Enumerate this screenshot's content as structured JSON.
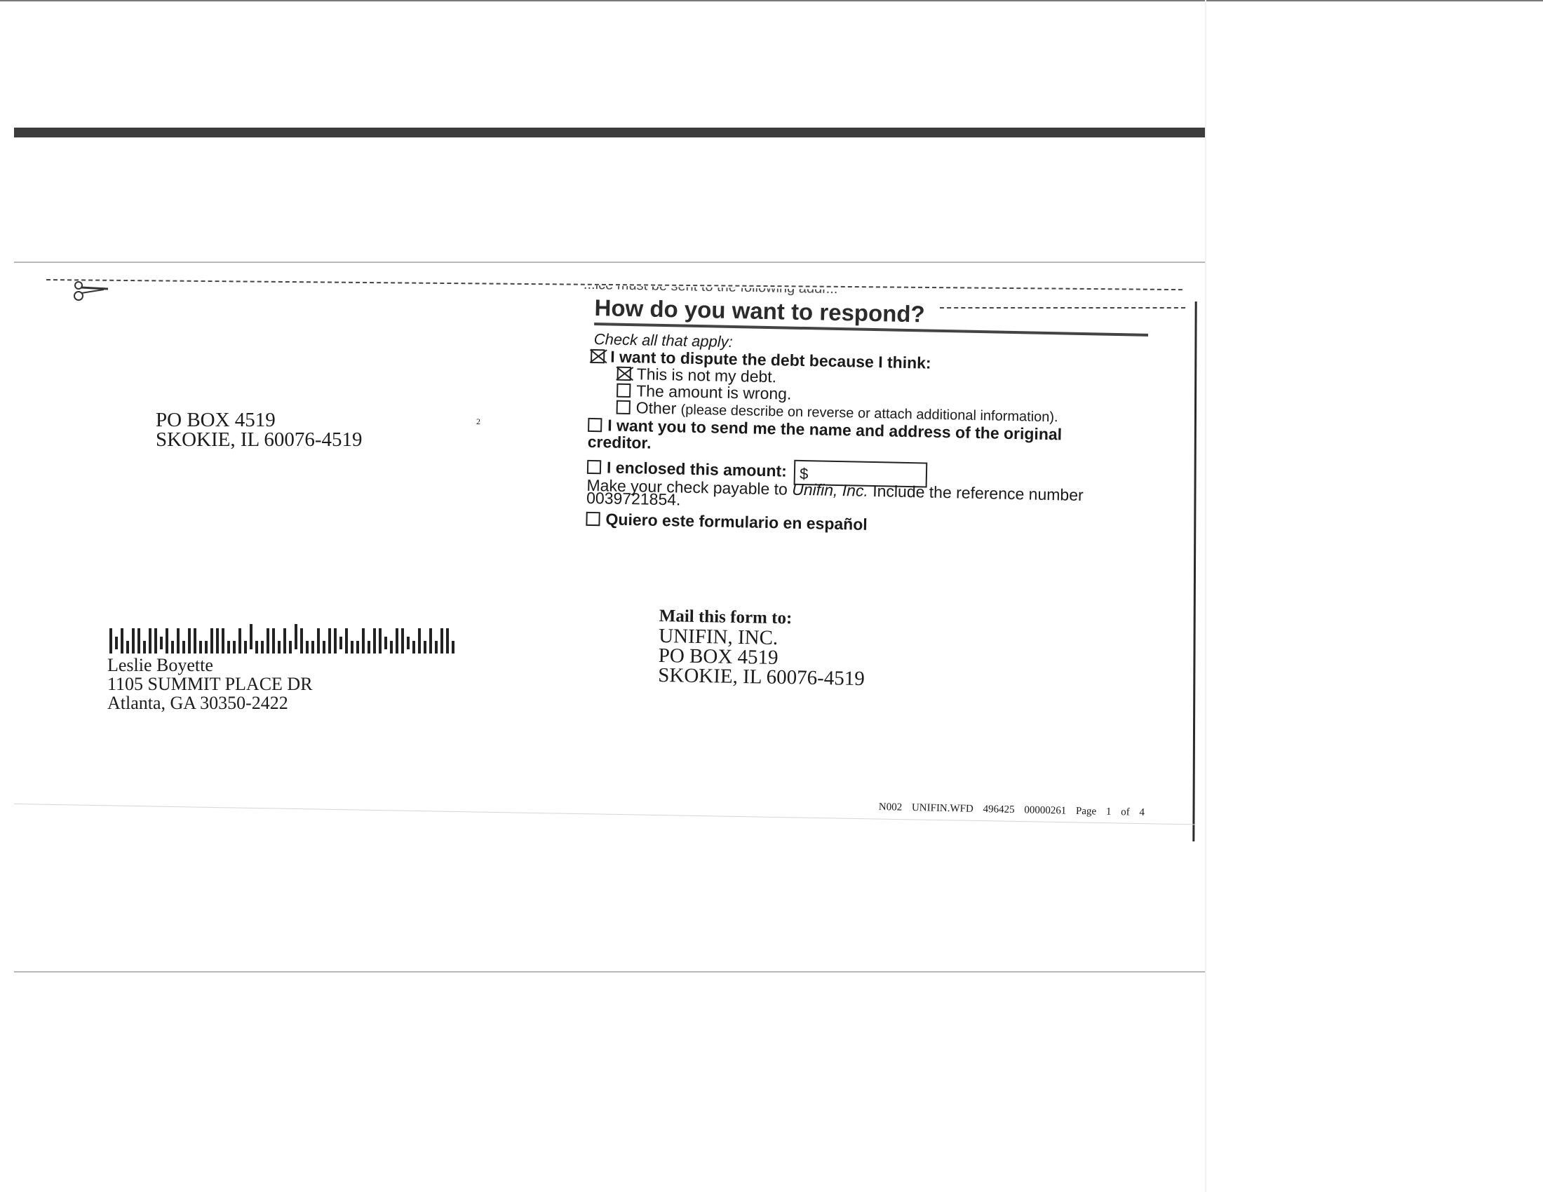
{
  "header": {
    "cut_text": "...ice must be sent to the following addr..."
  },
  "return_address": {
    "line1": "PO BOX 4519",
    "line2": "SKOKIE, IL 60076-4519",
    "marker": "2"
  },
  "form": {
    "title": "How do you want to respond?",
    "check_all": "Check all that apply:",
    "dispute_label": "I want to dispute the debt because I think:",
    "dispute_checked": true,
    "not_my_debt": "This is not my debt.",
    "not_my_debt_checked": true,
    "amount_wrong": "The amount is wrong.",
    "other_label": "Other",
    "other_note": "(please describe on reverse or attach additional information).",
    "creditor_line1": "I want you to send me the name and address of the original",
    "creditor_line2": "creditor.",
    "enclosed_label": "I enclosed this amount:",
    "enclosed_value": "$",
    "payable_prefix": "Make your check payable to ",
    "payable_name": "Unifin, Inc.",
    "payable_suffix": " Include the reference number",
    "reference_number": "0039721854.",
    "spanish_label": "Quiero este formulario en español"
  },
  "recipient": {
    "name": "Leslie Boyette",
    "street": "1105 SUMMIT PLACE DR",
    "city": "Atlanta, GA  30350-2422"
  },
  "mail_to": {
    "heading": "Mail this form to:",
    "company": "UNIFIN, INC.",
    "box": "PO BOX 4519",
    "city": "SKOKIE, IL 60076-4519"
  },
  "footer": {
    "code": "N002  UNIFIN.WFD  496425  00000261  Page 1 of 4"
  },
  "icons": {
    "scissors": "scissors-icon",
    "barcode": "postal-barcode"
  }
}
